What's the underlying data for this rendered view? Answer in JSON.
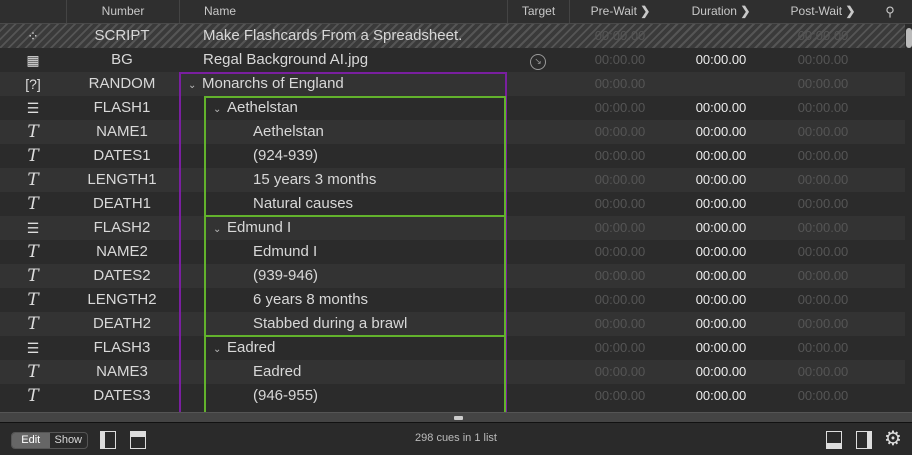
{
  "columns": {
    "number": "Number",
    "name": "Name",
    "target": "Target",
    "prewait": "Pre-Wait",
    "duration": "Duration",
    "postwait": "Post-Wait"
  },
  "cues": [
    {
      "icon": "group-icon",
      "glyph": "⁘",
      "number": "SCRIPT",
      "name": "Make Flashcards From a Spreadsheet.",
      "prewait": "00:00.00",
      "duration": "",
      "postwait": "00:00.00",
      "indent": 0,
      "script": true
    },
    {
      "icon": "video-icon",
      "glyph": "▦",
      "number": "BG",
      "name": "Regal Background AI.jpg",
      "target": "target-icon",
      "prewait": "00:00.00",
      "duration": "00:00.00",
      "postwait": "00:00.00",
      "indent": 0
    },
    {
      "icon": "random-group-icon",
      "glyph": "[?]",
      "number": "RANDOM",
      "name": "Monarchs of England",
      "prewait": "00:00.00",
      "duration": "",
      "postwait": "00:00.00",
      "indent": 0,
      "chevron": true
    },
    {
      "icon": "timeline-group-icon",
      "glyph": "☰",
      "number": "FLASH1",
      "name": "Aethelstan",
      "prewait": "00:00.00",
      "duration": "00:00.00",
      "postwait": "00:00.00",
      "indent": 1,
      "chevron": true
    },
    {
      "icon": "text-icon",
      "glyph": "T",
      "number": "NAME1",
      "name": "Aethelstan",
      "prewait": "00:00.00",
      "duration": "00:00.00",
      "postwait": "00:00.00",
      "indent": 2
    },
    {
      "icon": "text-icon",
      "glyph": "T",
      "number": "DATES1",
      "name": "(924-939)",
      "prewait": "00:00.00",
      "duration": "00:00.00",
      "postwait": "00:00.00",
      "indent": 2
    },
    {
      "icon": "text-icon",
      "glyph": "T",
      "number": "LENGTH1",
      "name": "15 years 3 months",
      "prewait": "00:00.00",
      "duration": "00:00.00",
      "postwait": "00:00.00",
      "indent": 2
    },
    {
      "icon": "text-icon",
      "glyph": "T",
      "number": "DEATH1",
      "name": "Natural causes",
      "prewait": "00:00.00",
      "duration": "00:00.00",
      "postwait": "00:00.00",
      "indent": 2
    },
    {
      "icon": "timeline-group-icon",
      "glyph": "☰",
      "number": "FLASH2",
      "name": "Edmund I",
      "prewait": "00:00.00",
      "duration": "00:00.00",
      "postwait": "00:00.00",
      "indent": 1,
      "chevron": true
    },
    {
      "icon": "text-icon",
      "glyph": "T",
      "number": "NAME2",
      "name": "Edmund I",
      "prewait": "00:00.00",
      "duration": "00:00.00",
      "postwait": "00:00.00",
      "indent": 2
    },
    {
      "icon": "text-icon",
      "glyph": "T",
      "number": "DATES2",
      "name": "(939-946)",
      "prewait": "00:00.00",
      "duration": "00:00.00",
      "postwait": "00:00.00",
      "indent": 2
    },
    {
      "icon": "text-icon",
      "glyph": "T",
      "number": "LENGTH2",
      "name": "6 years 8 months",
      "prewait": "00:00.00",
      "duration": "00:00.00",
      "postwait": "00:00.00",
      "indent": 2
    },
    {
      "icon": "text-icon",
      "glyph": "T",
      "number": "DEATH2",
      "name": "Stabbed during a brawl",
      "prewait": "00:00.00",
      "duration": "00:00.00",
      "postwait": "00:00.00",
      "indent": 2
    },
    {
      "icon": "timeline-group-icon",
      "glyph": "☰",
      "number": "FLASH3",
      "name": "Eadred",
      "prewait": "00:00.00",
      "duration": "00:00.00",
      "postwait": "00:00.00",
      "indent": 1,
      "chevron": true
    },
    {
      "icon": "text-icon",
      "glyph": "T",
      "number": "NAME3",
      "name": "Eadred",
      "prewait": "00:00.00",
      "duration": "00:00.00",
      "postwait": "00:00.00",
      "indent": 2
    },
    {
      "icon": "text-icon",
      "glyph": "T",
      "number": "DATES3",
      "name": "(946-955)",
      "prewait": "00:00.00",
      "duration": "00:00.00",
      "postwait": "00:00.00",
      "indent": 2
    }
  ],
  "footer": {
    "edit": "Edit",
    "show": "Show",
    "status": "298 cues in 1 list"
  },
  "colors": {
    "random_group": "#7a1fa0",
    "timeline_group": "#62b22c"
  }
}
